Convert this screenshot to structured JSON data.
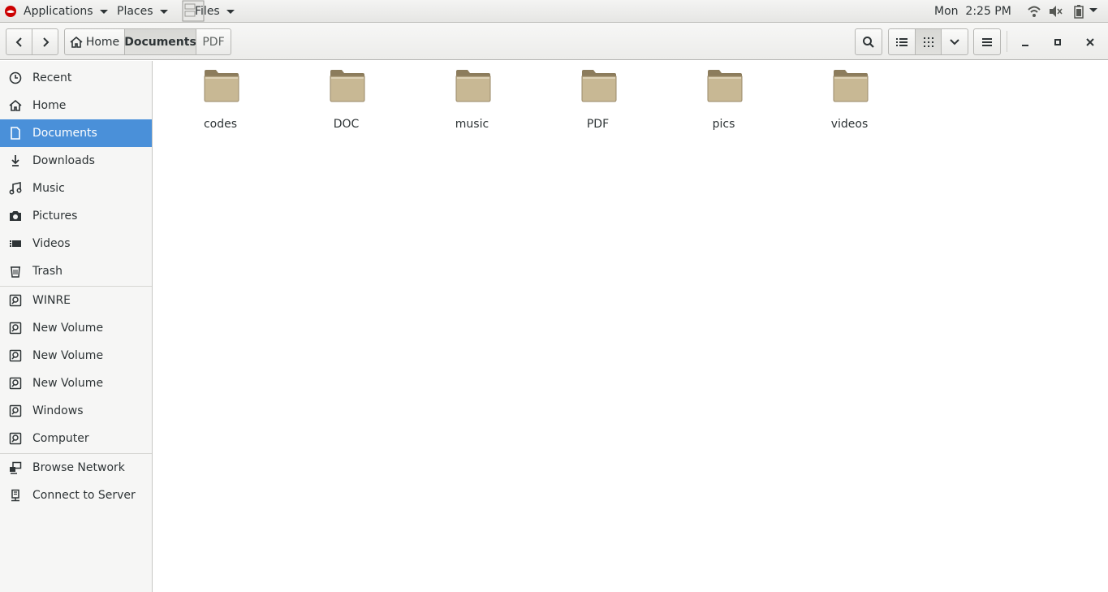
{
  "top_panel": {
    "applications_label": "Applications",
    "places_label": "Places",
    "files_label": "Files",
    "clock": "Mon  2:25 PM"
  },
  "header": {
    "breadcrumbs": [
      "Home",
      "Documents",
      "PDF"
    ],
    "active_breadcrumb": "Documents"
  },
  "sidebar": {
    "places": [
      {
        "label": "Recent",
        "icon": "clock-icon"
      },
      {
        "label": "Home",
        "icon": "home-icon"
      },
      {
        "label": "Documents",
        "icon": "document-icon",
        "selected": true
      },
      {
        "label": "Downloads",
        "icon": "download-icon"
      },
      {
        "label": "Music",
        "icon": "music-icon"
      },
      {
        "label": "Pictures",
        "icon": "camera-icon"
      },
      {
        "label": "Videos",
        "icon": "video-icon"
      },
      {
        "label": "Trash",
        "icon": "trash-icon"
      }
    ],
    "devices": [
      {
        "label": "WINRE",
        "icon": "drive-icon"
      },
      {
        "label": "New Volume",
        "icon": "drive-icon"
      },
      {
        "label": "New Volume",
        "icon": "drive-icon"
      },
      {
        "label": "New Volume",
        "icon": "drive-icon"
      },
      {
        "label": "Windows",
        "icon": "drive-icon"
      },
      {
        "label": "Computer",
        "icon": "drive-icon"
      }
    ],
    "network": [
      {
        "label": "Browse Network",
        "icon": "network-icon"
      },
      {
        "label": "Connect to Server",
        "icon": "server-icon"
      }
    ]
  },
  "main": {
    "folders": [
      "codes",
      "DOC",
      "music",
      "PDF",
      "pics",
      "videos"
    ]
  },
  "colors": {
    "selection": "#4a90d9",
    "folder": "#c8b894"
  }
}
